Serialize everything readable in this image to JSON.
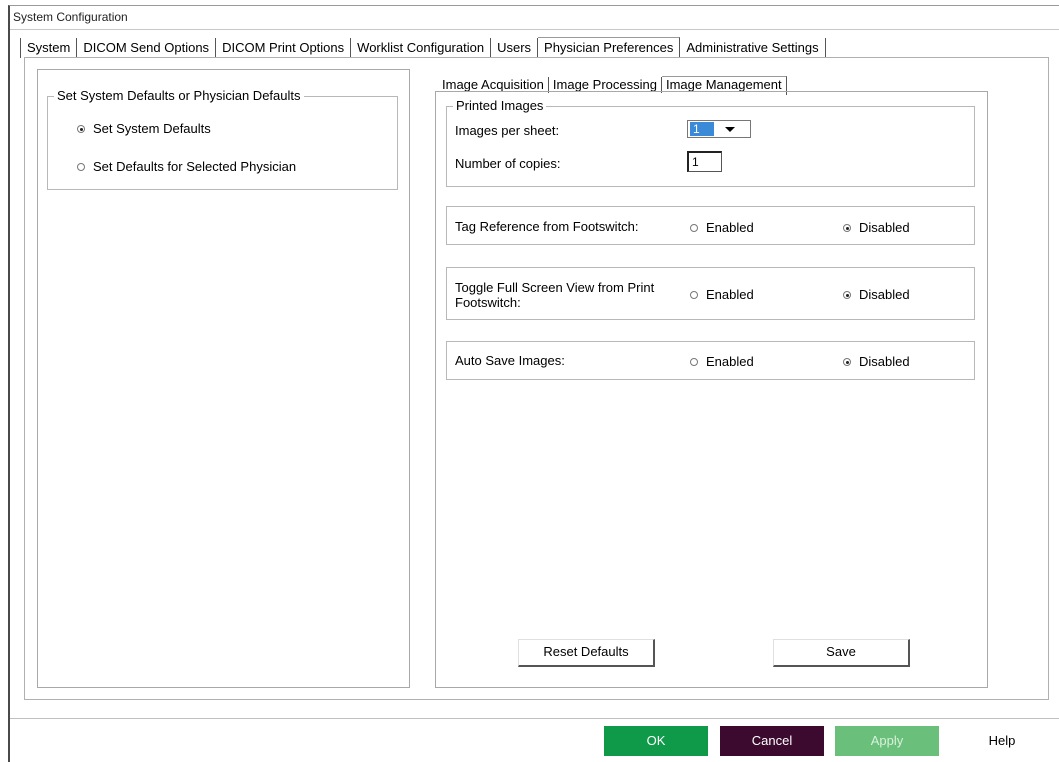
{
  "window": {
    "title": "System Configuration"
  },
  "tabs": [
    "System",
    "DICOM Send Options",
    "DICOM Print Options",
    "Worklist Configuration",
    "Users",
    "Physician Preferences",
    "Administrative Settings"
  ],
  "left": {
    "group_title": "Set System Defaults or Physician Defaults",
    "options": [
      {
        "label": "Set System Defaults",
        "checked": true
      },
      {
        "label": "Set Defaults for Selected Physician",
        "checked": false
      }
    ]
  },
  "subtabs": [
    "Image Acquisition",
    "Image Processing",
    "Image Management"
  ],
  "printed": {
    "group_title": "Printed Images",
    "images_per_sheet_label": "Images per sheet:",
    "images_per_sheet_value": "1",
    "copies_label": "Number of copies:",
    "copies_value": "1"
  },
  "settings": [
    {
      "label": "Tag Reference from Footswitch:",
      "enabled": "Enabled",
      "disabled": "Disabled",
      "selected": "Disabled"
    },
    {
      "label": "Toggle Full Screen View from Print Footswitch:",
      "enabled": "Enabled",
      "disabled": "Disabled",
      "selected": "Disabled"
    },
    {
      "label": "Auto Save Images:",
      "enabled": "Enabled",
      "disabled": "Disabled",
      "selected": "Disabled"
    }
  ],
  "buttons": {
    "reset": "Reset Defaults",
    "save": "Save",
    "ok": "OK",
    "cancel": "Cancel",
    "apply": "Apply",
    "help": "Help"
  },
  "colors": {
    "ok_bg": "#0f9a4a",
    "cancel_bg": "#3b0a2e",
    "apply_bg": "#6ac07a",
    "selection": "#3b8ad8"
  }
}
